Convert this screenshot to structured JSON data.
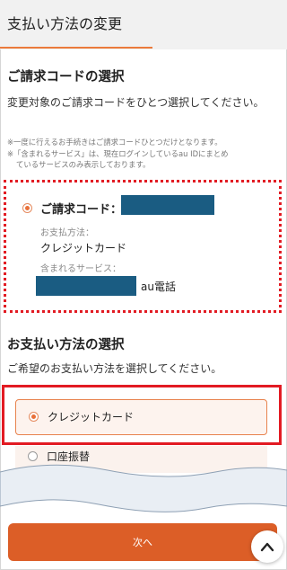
{
  "header": {
    "title": "支払い方法の変更"
  },
  "billing_section": {
    "title": "ご請求コードの選択",
    "instruction": "変更対象のご請求コードをひとつ選択してください。",
    "notes": [
      "※一度に行えるお手続きはご請求コードひとつだけとなります。",
      "※「含まれるサービス」は、現在ログインしているau IDにまとめ",
      "ているサービスのみ表示しております。"
    ],
    "card": {
      "code_label": "ご請求コード：",
      "payment_method_label": "お支払方法：",
      "payment_method_value": "クレジットカード",
      "services_label": "含まれるサービス：",
      "service_name": "au電話"
    }
  },
  "payment_section": {
    "title": "お支払い方法の選択",
    "instruction": "ご希望のお支払い方法を選択してください。",
    "options": [
      {
        "label": "クレジットカード",
        "selected": true
      },
      {
        "label": "口座振替",
        "selected": false
      }
    ]
  },
  "actions": {
    "next_label": "次へ"
  },
  "colors": {
    "accent": "#dc5e27",
    "highlight_red": "#e21b23",
    "mask_blue": "#1a5c82"
  },
  "icons": {
    "scroll_top": "chevron-up-icon"
  }
}
